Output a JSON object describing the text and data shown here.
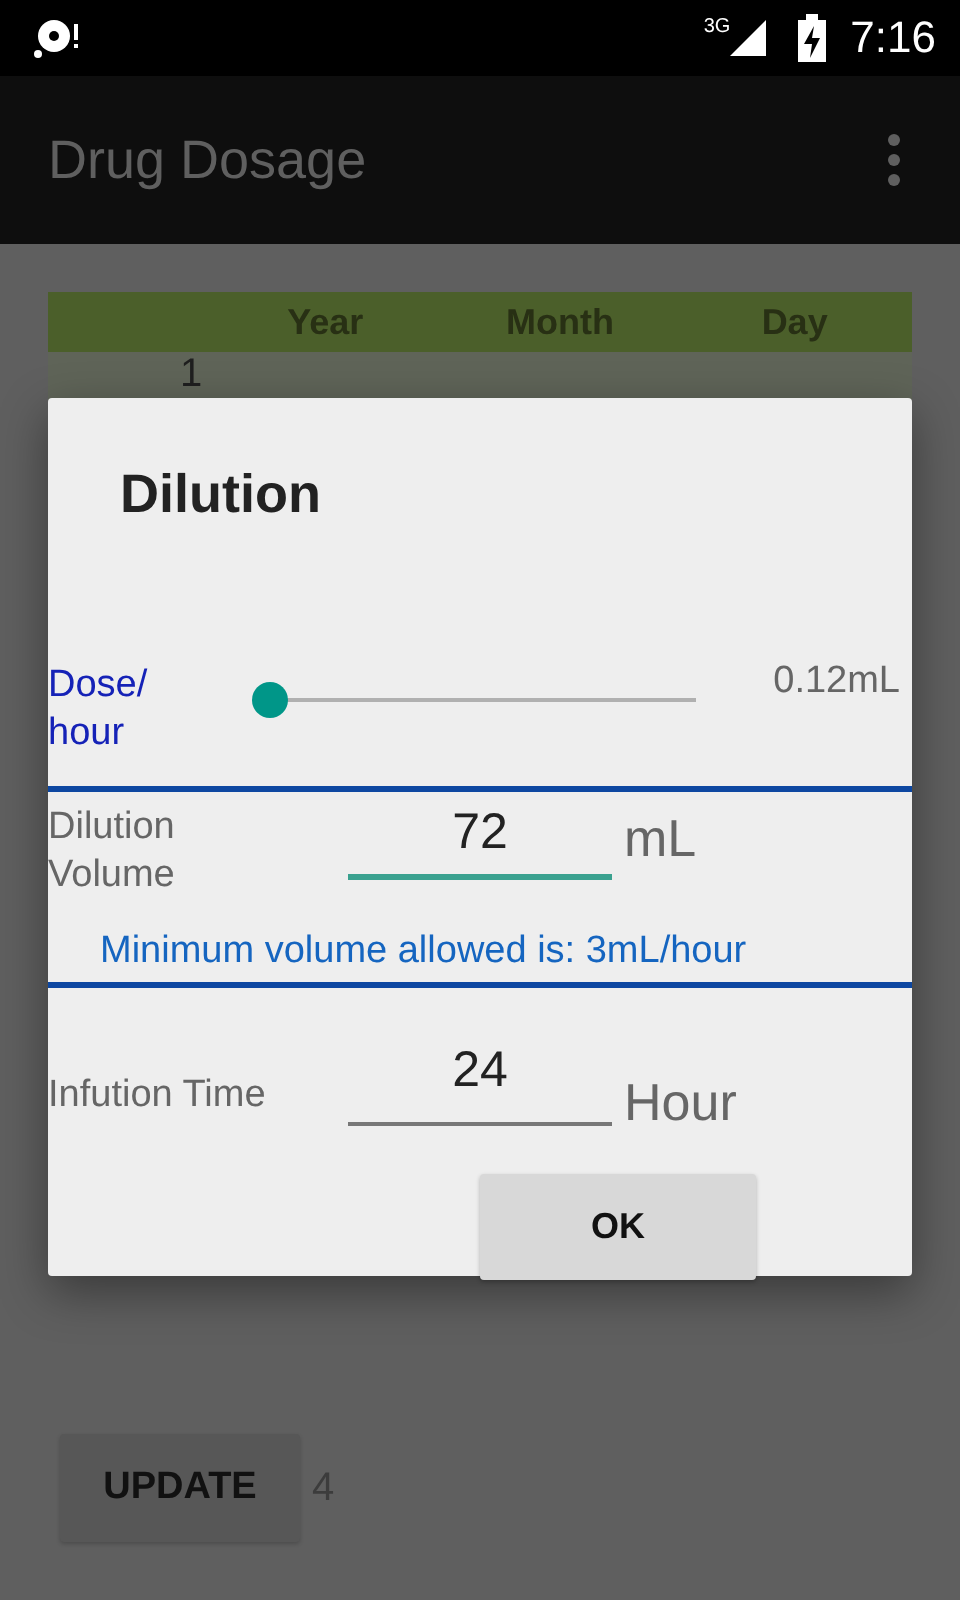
{
  "status_bar": {
    "network": "3G",
    "time": "7:16"
  },
  "app_bar": {
    "title": "Drug Dosage"
  },
  "table": {
    "columns": [
      "Year",
      "Month",
      "Day"
    ],
    "rows": [
      [
        "1"
      ]
    ]
  },
  "update_button": {
    "label": "UPDATE",
    "count": "4"
  },
  "dialog": {
    "title": "Dilution",
    "dose": {
      "label": "Dose/ hour",
      "level": 0,
      "reading": "0.12mL"
    },
    "volume": {
      "label": "Dilution Volume",
      "value": "72",
      "unit": "mL",
      "focused": true
    },
    "hint": "Minimum volume allowed is: 3mL/hour",
    "time": {
      "label": "Infution Time",
      "value": "24",
      "unit": "Hour",
      "focused": false
    },
    "ok": "OK"
  }
}
